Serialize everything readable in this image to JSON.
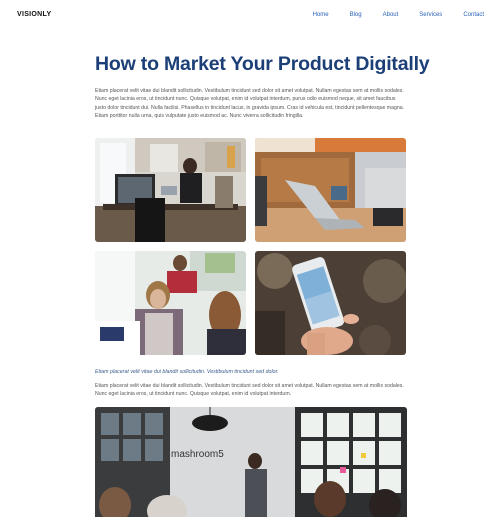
{
  "header": {
    "brand": "VISIONLY",
    "nav": [
      "Home",
      "Blog",
      "About",
      "Services",
      "Contact"
    ]
  },
  "article": {
    "title": "How to Market Your Product Digitally",
    "intro": "Etiam placerat velit vitae dui blandit sollicitudin. Vestibulum tincidunt sed dolor sit amet volutpat. Nullam egestas sem at mollis sodales. Nunc eget lacinia eros, ut tincidunt nunc. Quisque volutpat, enim id volutpat interdum, purus odio euismod neque, sit amet faucibus justo dolor tincidunt dui. Nulla facilisi. Phasellus in tincidunt lacus, in gravida ipsum. Cras id vehicula est, tincidunt pellentesque magna. Etiam porttitor nulla urna, quis vulputate justo euismod ac. Nunc viverra sollicitudin fringilla.",
    "caption": "Etiam placerat velit vitae dui blandit sollicitudin. Vestibulum tincidunt sed dolor.",
    "body": "Etiam placerat velit vitae dui blandit sollicitudin. Vestibulum tincidunt sed dolor sit amet volutpat. Nullam egestas sem at mollis sodales. Nunc eget lacinia eros, ut tincidunt nunc. Quisque volutpat, enim id volutpat interdum.",
    "wall_sign": "mashroom5"
  }
}
